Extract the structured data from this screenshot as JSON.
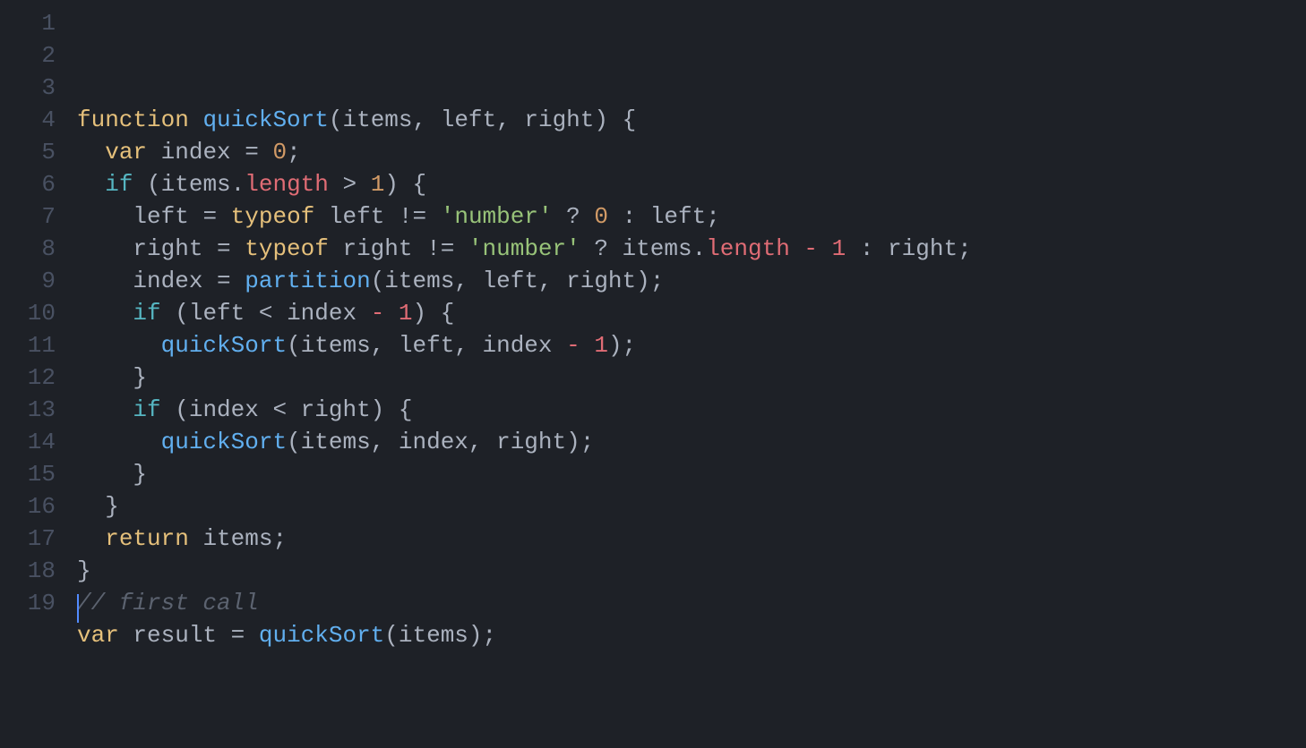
{
  "editor": {
    "language": "javascript",
    "theme": "one-dark",
    "font": "Menlo",
    "line_numbers": [
      1,
      2,
      3,
      4,
      5,
      6,
      7,
      8,
      9,
      10,
      11,
      12,
      13,
      14,
      15,
      16,
      17,
      18,
      19
    ],
    "cursor": {
      "line": 19,
      "col": 1
    },
    "colors": {
      "background": "#1e2127",
      "foreground": "#abb2bf",
      "gutter": "#495162",
      "keyword_gold": "#e5c07b",
      "keyword_cyan": "#56b6c2",
      "function_blue": "#61afef",
      "property_red": "#e06c75",
      "string_green": "#98c379",
      "number_orange": "#d19a66",
      "comment_gray": "#5c6370"
    },
    "lines": [
      {
        "n": 1,
        "plain": ""
      },
      {
        "n": 2,
        "plain": "function quickSort(items, left, right) {",
        "tokens": [
          {
            "t": "function",
            "c": "kw"
          },
          {
            "t": " ",
            "c": "punc"
          },
          {
            "t": "quickSort",
            "c": "fn"
          },
          {
            "t": "(",
            "c": "punc"
          },
          {
            "t": "items",
            "c": "param"
          },
          {
            "t": ", ",
            "c": "punc"
          },
          {
            "t": "left",
            "c": "param"
          },
          {
            "t": ", ",
            "c": "punc"
          },
          {
            "t": "right",
            "c": "param"
          },
          {
            "t": ") {",
            "c": "punc"
          }
        ]
      },
      {
        "n": 3,
        "plain": "  var index = 0;",
        "tokens": [
          {
            "t": "  ",
            "c": "punc"
          },
          {
            "t": "var",
            "c": "kw"
          },
          {
            "t": " index ",
            "c": "ident"
          },
          {
            "t": "=",
            "c": "op"
          },
          {
            "t": " ",
            "c": "punc"
          },
          {
            "t": "0",
            "c": "num"
          },
          {
            "t": ";",
            "c": "punc"
          }
        ]
      },
      {
        "n": 4,
        "plain": "  if (items.length > 1) {",
        "tokens": [
          {
            "t": "  ",
            "c": "punc"
          },
          {
            "t": "if",
            "c": "kw2"
          },
          {
            "t": " (items",
            "c": "ident"
          },
          {
            "t": ".",
            "c": "punc"
          },
          {
            "t": "length",
            "c": "prop"
          },
          {
            "t": " > ",
            "c": "op"
          },
          {
            "t": "1",
            "c": "num"
          },
          {
            "t": ") {",
            "c": "punc"
          }
        ]
      },
      {
        "n": 5,
        "plain": "    left = typeof left != 'number' ? 0 : left;",
        "tokens": [
          {
            "t": "    left ",
            "c": "ident"
          },
          {
            "t": "=",
            "c": "op"
          },
          {
            "t": " ",
            "c": "punc"
          },
          {
            "t": "typeof",
            "c": "kw"
          },
          {
            "t": " left ",
            "c": "ident"
          },
          {
            "t": "!=",
            "c": "op"
          },
          {
            "t": " ",
            "c": "punc"
          },
          {
            "t": "'number'",
            "c": "str"
          },
          {
            "t": " ? ",
            "c": "op"
          },
          {
            "t": "0",
            "c": "num"
          },
          {
            "t": " : left;",
            "c": "ident"
          }
        ]
      },
      {
        "n": 6,
        "plain": "    right = typeof right != 'number' ? items.length - 1 : right;",
        "tokens": [
          {
            "t": "    right ",
            "c": "ident"
          },
          {
            "t": "=",
            "c": "op"
          },
          {
            "t": " ",
            "c": "punc"
          },
          {
            "t": "typeof",
            "c": "kw"
          },
          {
            "t": " right ",
            "c": "ident"
          },
          {
            "t": "!=",
            "c": "op"
          },
          {
            "t": " ",
            "c": "punc"
          },
          {
            "t": "'number'",
            "c": "str"
          },
          {
            "t": " ? items",
            "c": "ident"
          },
          {
            "t": ".",
            "c": "punc"
          },
          {
            "t": "length",
            "c": "prop"
          },
          {
            "t": " ",
            "c": "punc"
          },
          {
            "t": "-",
            "c": "opred"
          },
          {
            "t": " ",
            "c": "punc"
          },
          {
            "t": "1",
            "c": "num2"
          },
          {
            "t": " : right;",
            "c": "ident"
          }
        ]
      },
      {
        "n": 7,
        "plain": "    index = partition(items, left, right);",
        "tokens": [
          {
            "t": "    index ",
            "c": "ident"
          },
          {
            "t": "=",
            "c": "op"
          },
          {
            "t": " ",
            "c": "punc"
          },
          {
            "t": "partition",
            "c": "fn"
          },
          {
            "t": "(items, left, right);",
            "c": "ident"
          }
        ]
      },
      {
        "n": 8,
        "plain": "    if (left < index - 1) {",
        "tokens": [
          {
            "t": "    ",
            "c": "punc"
          },
          {
            "t": "if",
            "c": "kw2"
          },
          {
            "t": " (left < index ",
            "c": "ident"
          },
          {
            "t": "-",
            "c": "opred"
          },
          {
            "t": " ",
            "c": "punc"
          },
          {
            "t": "1",
            "c": "num2"
          },
          {
            "t": ") {",
            "c": "punc"
          }
        ]
      },
      {
        "n": 9,
        "plain": "      quickSort(items, left, index - 1);",
        "tokens": [
          {
            "t": "      ",
            "c": "punc"
          },
          {
            "t": "quickSort",
            "c": "fn"
          },
          {
            "t": "(items, left, index ",
            "c": "ident"
          },
          {
            "t": "-",
            "c": "opred"
          },
          {
            "t": " ",
            "c": "punc"
          },
          {
            "t": "1",
            "c": "num2"
          },
          {
            "t": ");",
            "c": "punc"
          }
        ]
      },
      {
        "n": 10,
        "plain": "    }",
        "tokens": [
          {
            "t": "    }",
            "c": "punc"
          }
        ]
      },
      {
        "n": 11,
        "plain": "    if (index < right) {",
        "tokens": [
          {
            "t": "    ",
            "c": "punc"
          },
          {
            "t": "if",
            "c": "kw2"
          },
          {
            "t": " (index < right) {",
            "c": "ident"
          }
        ]
      },
      {
        "n": 12,
        "plain": "      quickSort(items, index, right);",
        "tokens": [
          {
            "t": "      ",
            "c": "punc"
          },
          {
            "t": "quickSort",
            "c": "fn"
          },
          {
            "t": "(items, index, right);",
            "c": "ident"
          }
        ]
      },
      {
        "n": 13,
        "plain": "    }",
        "tokens": [
          {
            "t": "    }",
            "c": "punc"
          }
        ]
      },
      {
        "n": 14,
        "plain": "  }",
        "tokens": [
          {
            "t": "  }",
            "c": "punc"
          }
        ]
      },
      {
        "n": 15,
        "plain": "  return items;",
        "tokens": [
          {
            "t": "  ",
            "c": "punc"
          },
          {
            "t": "return",
            "c": "kw"
          },
          {
            "t": " items;",
            "c": "ident"
          }
        ]
      },
      {
        "n": 16,
        "plain": "}",
        "tokens": [
          {
            "t": "}",
            "c": "punc"
          }
        ]
      },
      {
        "n": 17,
        "plain": "// first call",
        "tokens": [
          {
            "t": "// first call",
            "c": "comment"
          }
        ]
      },
      {
        "n": 18,
        "plain": "var result = quickSort(items);",
        "tokens": [
          {
            "t": "var",
            "c": "kw"
          },
          {
            "t": " result ",
            "c": "ident"
          },
          {
            "t": "=",
            "c": "op"
          },
          {
            "t": " ",
            "c": "punc"
          },
          {
            "t": "quickSort",
            "c": "fn"
          },
          {
            "t": "(items);",
            "c": "ident"
          }
        ]
      },
      {
        "n": 19,
        "plain": "",
        "tokens": []
      }
    ]
  }
}
